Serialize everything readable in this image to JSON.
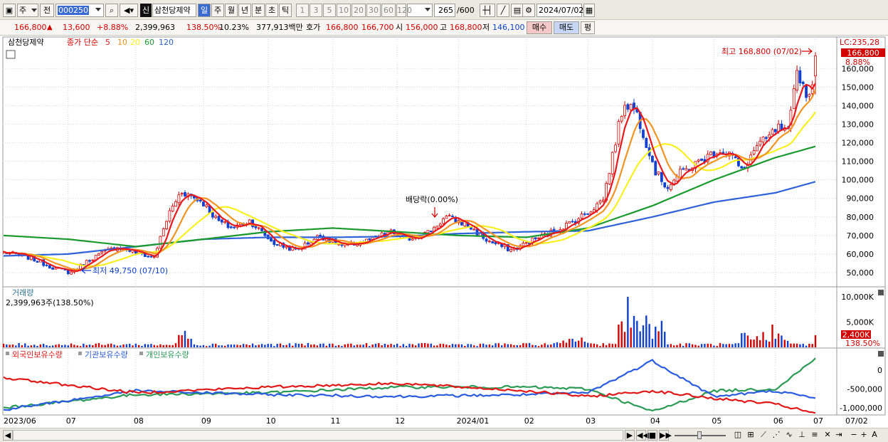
{
  "toolbar": {
    "market": "주",
    "prefix": "전",
    "code": "000250",
    "stock_name": "삼천당제약",
    "stock_badge": "신",
    "periods": [
      "일",
      "주",
      "월",
      "년",
      "분",
      "초",
      "틱"
    ],
    "intervals": [
      "1",
      "3",
      "5",
      "10",
      "20",
      "30",
      "60",
      "120"
    ],
    "count": "265",
    "count_total": "/600",
    "date": "2024/07/02"
  },
  "info": {
    "price": "166,800",
    "change_arrow": "▲",
    "change": "13,600",
    "change_pct": "+8.88%",
    "volume": "2,399,963",
    "volume_ratio": "138.50%",
    "turnover": "10.23%",
    "amount": "377,913백만",
    "quote_label": "호가",
    "quote_ask": "166,800",
    "quote_bid": "166,700",
    "open_label": "시",
    "open": "156,000",
    "high_label": "고",
    "high": "168,800",
    "low_label": "저",
    "low": "146,100",
    "buy_label": "매수",
    "sell_label": "매도",
    "avg_label": "평"
  },
  "colors": {
    "up": "#d40000",
    "down": "#1040d0",
    "ma5": "#e8181c",
    "ma10": "#f39321",
    "ma20": "#f8f021",
    "ma60": "#1a9a2e",
    "ma120": "#2f62d8",
    "foreign": "#e11818",
    "institution": "#2b5ce0",
    "individual": "#2a9a55"
  },
  "price_panel": {
    "stock_label": "삼천당제약",
    "indicator_label": "종가 단순",
    "ma_periods": [
      "5",
      "10",
      "20",
      "60",
      "120"
    ],
    "lc_label": "LC:235,28",
    "current_tag": "166,800",
    "current_pct": "8.88%",
    "high_annotation": "최고 168,800 (07/02)",
    "low_annotation": "최저 49,750 (07/10)",
    "dividend_annotation": "배당락(0.00%)",
    "y_ticks": [
      "160,000",
      "150,000",
      "140,000",
      "130,000",
      "120,000",
      "110,000",
      "100,000",
      "90,000",
      "80,000",
      "70,000",
      "60,000",
      "50,000"
    ]
  },
  "volume_panel": {
    "title": "거래량",
    "value": "2,399,963주(138.50%)",
    "y_ticks": [
      "10,000K",
      "5,000K"
    ],
    "current_tag": "2,400K",
    "current_pct": "138.50%"
  },
  "holdings_panel": {
    "legend": [
      "외국인보유수량",
      "기관보유수량",
      "개인보유수량"
    ],
    "y_ticks": [
      "0",
      "-500,000",
      "-1,000,000"
    ]
  },
  "x_axis": {
    "months": [
      "2023/06",
      "07",
      "08",
      "09",
      "10",
      "11",
      "12",
      "2024/01",
      "02",
      "03",
      "04",
      "05",
      "06",
      "07"
    ],
    "right_label": "07/02"
  },
  "chart_data": [
    {
      "type": "line",
      "title": "",
      "series_names": [
        "종가",
        "5",
        "10",
        "20",
        "60",
        "120"
      ],
      "x": [
        "2023-06",
        "2023-07",
        "2023-08",
        "2023-09",
        "2023-10",
        "2023-11",
        "2023-12",
        "2024-01",
        "2024-02",
        "2024-03",
        "2024-04",
        "2024-05",
        "2024-06",
        "2024-07-02"
      ],
      "close": [
        61000,
        52000,
        64000,
        92000,
        76000,
        64000,
        68000,
        78000,
        65000,
        85000,
        138000,
        102000,
        110000,
        166800
      ],
      "ma60": [
        70000,
        68000,
        64000,
        68000,
        72000,
        74000,
        72000,
        70000,
        69000,
        74000,
        86000,
        100000,
        112000,
        118000
      ],
      "ma120": [
        59000,
        60000,
        64000,
        68000,
        69000,
        69000,
        69500,
        71000,
        72000,
        72500,
        80000,
        88000,
        93000,
        99000
      ],
      "ylim": [
        45000,
        172000
      ],
      "high": 168800,
      "low": 49750
    },
    {
      "type": "bar",
      "title": "거래량",
      "x": [
        "2023-09",
        "2024-03",
        "2024-04",
        "2024-06",
        "2024-07-02"
      ],
      "values": [
        1800,
        10000,
        6500,
        4500,
        2400
      ],
      "ylim": [
        0,
        11000
      ],
      "unit": "K"
    },
    {
      "type": "line",
      "title": "",
      "series_names": [
        "외국인보유수량",
        "기관보유수량",
        "개인보유수량"
      ],
      "x": [
        "2023-06",
        "2023-08",
        "2023-10",
        "2023-12",
        "2024-02",
        "2024-03",
        "2024-04",
        "2024-05",
        "2024-06",
        "2024-07-02"
      ],
      "foreign": [
        -200000,
        -600000,
        -450000,
        -350000,
        -550000,
        -700000,
        -550000,
        -750000,
        -900000,
        -1150000
      ],
      "institution": [
        -1050000,
        -550000,
        -650000,
        -700000,
        -650000,
        -600000,
        250000,
        -700000,
        -550000,
        -750000
      ],
      "individual": [
        -1000000,
        -650000,
        -600000,
        -450000,
        -450000,
        -500000,
        -1100000,
        -550000,
        -500000,
        300000
      ],
      "ylim": [
        -1250000,
        400000
      ]
    }
  ]
}
